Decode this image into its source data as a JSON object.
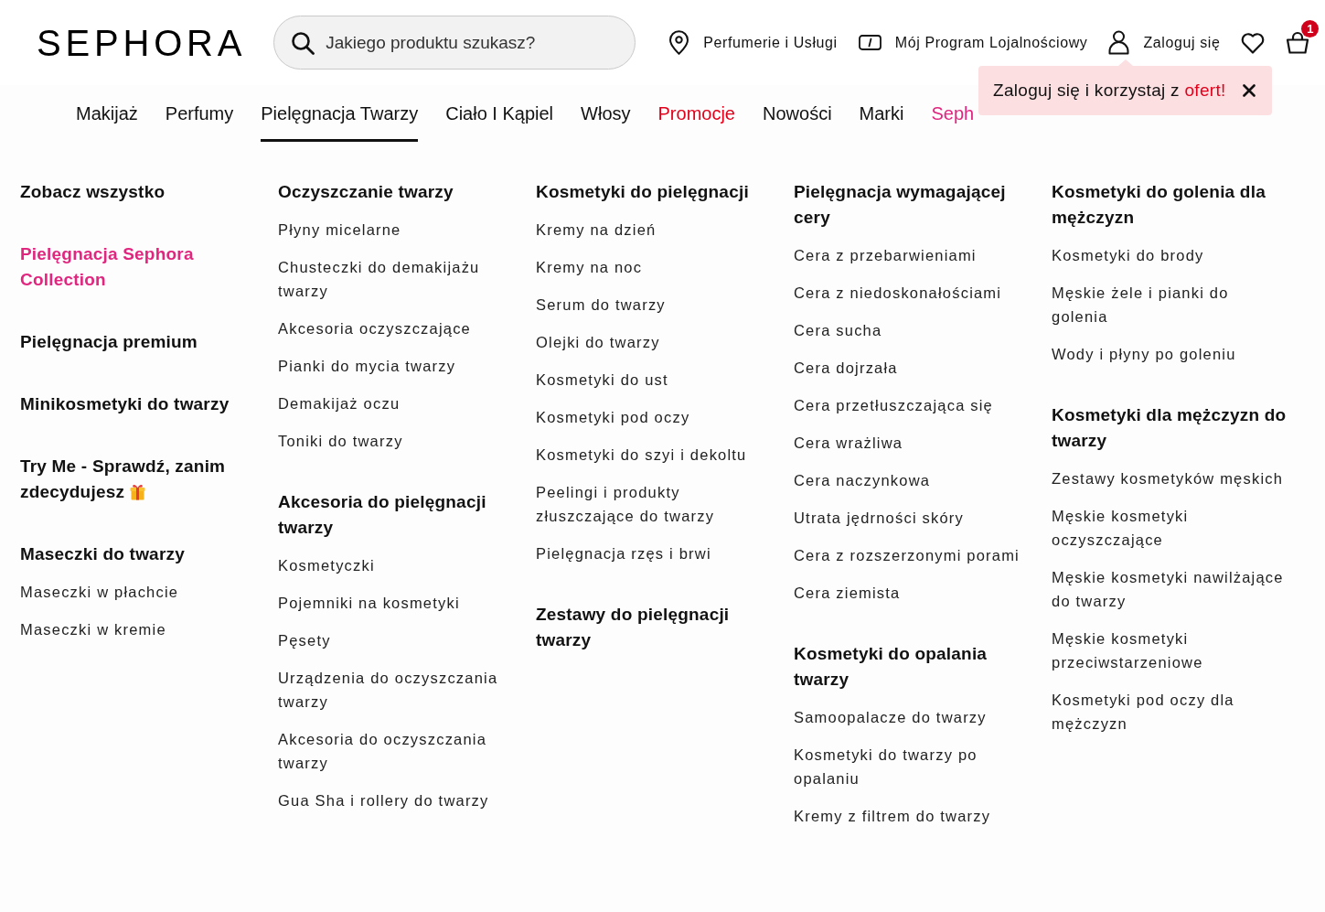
{
  "header": {
    "logo": "SEPHORA",
    "search": {
      "placeholder": "Jakiego produktu szukasz?"
    },
    "links": [
      {
        "kind": "location",
        "label": "Perfumerie i Usługi"
      },
      {
        "kind": "loyalty",
        "label": "Mój Program Lojalnościowy"
      },
      {
        "kind": "account",
        "label": "Zaloguj się"
      }
    ],
    "cart": {
      "count": "1"
    }
  },
  "nav": {
    "items": [
      {
        "label": "Makijaż",
        "kind": "regular",
        "selected": false
      },
      {
        "label": "Perfumy",
        "kind": "regular",
        "selected": false
      },
      {
        "label": "Pielęgnacja Twarzy",
        "kind": "regular",
        "selected": true
      },
      {
        "label": "Ciało I Kąpiel",
        "kind": "regular",
        "selected": false
      },
      {
        "label": "Włosy",
        "kind": "regular",
        "selected": false
      },
      {
        "label": "Promocje",
        "kind": "promo",
        "selected": false
      },
      {
        "label": "Nowości",
        "kind": "regular",
        "selected": false
      },
      {
        "label": "Marki",
        "kind": "regular",
        "selected": false
      },
      {
        "label": "Seph",
        "kind": "brand",
        "selected": false
      }
    ]
  },
  "tooltip": {
    "text": "Zaloguj się i korzystaj z",
    "highlight": "ofert!"
  },
  "menu": {
    "columns": [
      {
        "groups": [
          {
            "heading": "Zobacz wszystko",
            "kind": "regular"
          },
          {
            "heading": "Pielęgnacja Sephora Collection",
            "kind": "brand"
          },
          {
            "heading": "Pielęgnacja premium",
            "kind": "regular"
          },
          {
            "heading": "Minikosmetyki do twarzy",
            "kind": "regular"
          },
          {
            "heading": "Try Me - Sprawdź, zanim zdecydujesz",
            "kind": "regular",
            "has_icon": true
          },
          {
            "heading": "Maseczki do twarzy",
            "kind": "regular",
            "items": [
              "Maseczki w płachcie",
              "Maseczki w kremie"
            ]
          }
        ]
      },
      {
        "groups": [
          {
            "heading": "Oczyszczanie twarzy",
            "kind": "regular",
            "items": [
              "Płyny micelarne",
              "Chusteczki do demakijażu twarzy",
              "Akcesoria oczyszczające",
              "Pianki do mycia twarzy",
              "Demakijaż oczu",
              "Toniki do twarzy"
            ]
          },
          {
            "heading": "Akcesoria do pielęgnacji twarzy",
            "kind": "regular",
            "items": [
              "Kosmetyczki",
              "Pojemniki na kosmetyki",
              "Pęsety",
              "Urządzenia do oczyszczania twarzy",
              "Akcesoria do oczyszczania twarzy",
              "Gua Sha i rollery do twarzy"
            ]
          }
        ]
      },
      {
        "groups": [
          {
            "heading": "Kosmetyki do pielęgnacji",
            "kind": "regular",
            "items": [
              "Kremy na dzień",
              "Kremy na noc",
              "Serum do twarzy",
              "Olejki do twarzy",
              "Kosmetyki do ust",
              "Kosmetyki pod oczy",
              "Kosmetyki do szyi i dekoltu",
              "Peelingi i produkty złuszczające do twarzy",
              "Pielęgnacja rzęs i brwi"
            ]
          },
          {
            "heading": "Zestawy do pielęgnacji twarzy",
            "kind": "regular"
          }
        ]
      },
      {
        "groups": [
          {
            "heading": "Pielęgnacja wymagającej cery",
            "kind": "regular",
            "items": [
              "Cera z przebarwieniami",
              "Cera z niedoskonałościami",
              "Cera sucha",
              "Cera dojrzała",
              "Cera przetłuszczająca się",
              "Cera wrażliwa",
              "Cera naczynkowa",
              "Utrata jędrności skóry",
              "Cera z rozszerzonymi porami",
              "Cera ziemista"
            ]
          },
          {
            "heading": "Kosmetyki do opalania twarzy",
            "kind": "regular",
            "items": [
              "Samoopalacze do twarzy",
              "Kosmetyki do twarzy po opalaniu",
              "Kremy z filtrem do twarzy"
            ]
          }
        ]
      },
      {
        "groups": [
          {
            "heading": "Kosmetyki do golenia dla mężczyzn",
            "kind": "regular",
            "items": [
              "Kosmetyki do brody",
              "Męskie żele i pianki do golenia",
              "Wody i płyny po goleniu"
            ]
          },
          {
            "heading": "Kosmetyki dla mężczyzn do twarzy",
            "kind": "regular",
            "items": [
              "Zestawy kosmetyków męskich",
              "Męskie kosmetyki oczyszczające",
              "Męskie kosmetyki nawilżające do twarzy",
              "Męskie kosmetyki przeciwstarzeniowe",
              "Kosmetyki pod oczy dla mężczyzn"
            ]
          }
        ]
      }
    ]
  }
}
